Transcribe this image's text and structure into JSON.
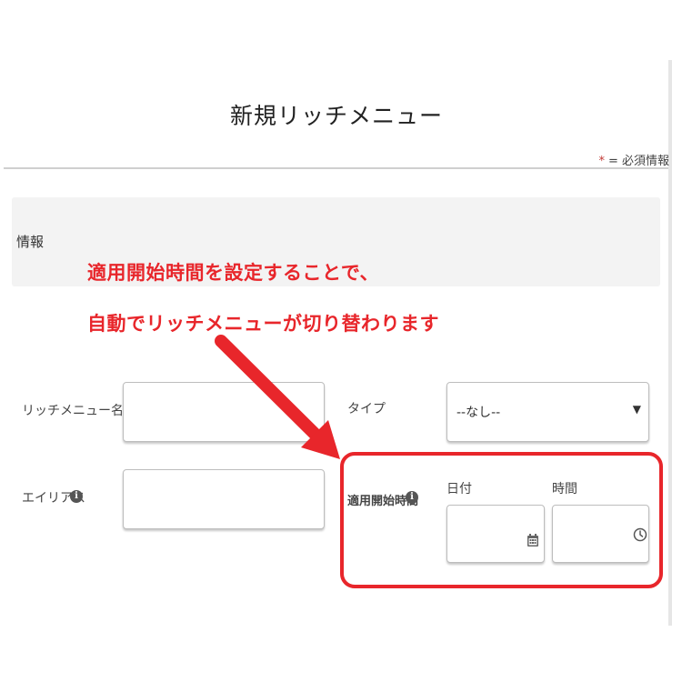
{
  "modal": {
    "title": "新規リッチメニュー",
    "required_legend": {
      "asterisk": "*",
      "text": "= 必須情報"
    }
  },
  "section": {
    "title": "情報"
  },
  "annotation": {
    "line1": "適用開始時間を設定することで、",
    "line2": "自動でリッチメニューが切り替わります",
    "color": "#e8262b"
  },
  "fields": {
    "richmenu_name": {
      "label": "リッチメニュー名",
      "value": ""
    },
    "alias": {
      "label": "エイリアス",
      "value": ""
    },
    "type": {
      "label": "タイプ",
      "selected": "--なし--"
    },
    "start_time": {
      "label": "適用開始時間",
      "date_label": "日付",
      "date_value": "",
      "time_label": "時間",
      "time_value": ""
    }
  },
  "icons": {
    "info": "info-icon",
    "calendar": "calendar-icon",
    "clock": "clock-icon",
    "chevron": "chevron-down-icon",
    "info_glyph": "i",
    "chevron_glyph": "▼"
  }
}
